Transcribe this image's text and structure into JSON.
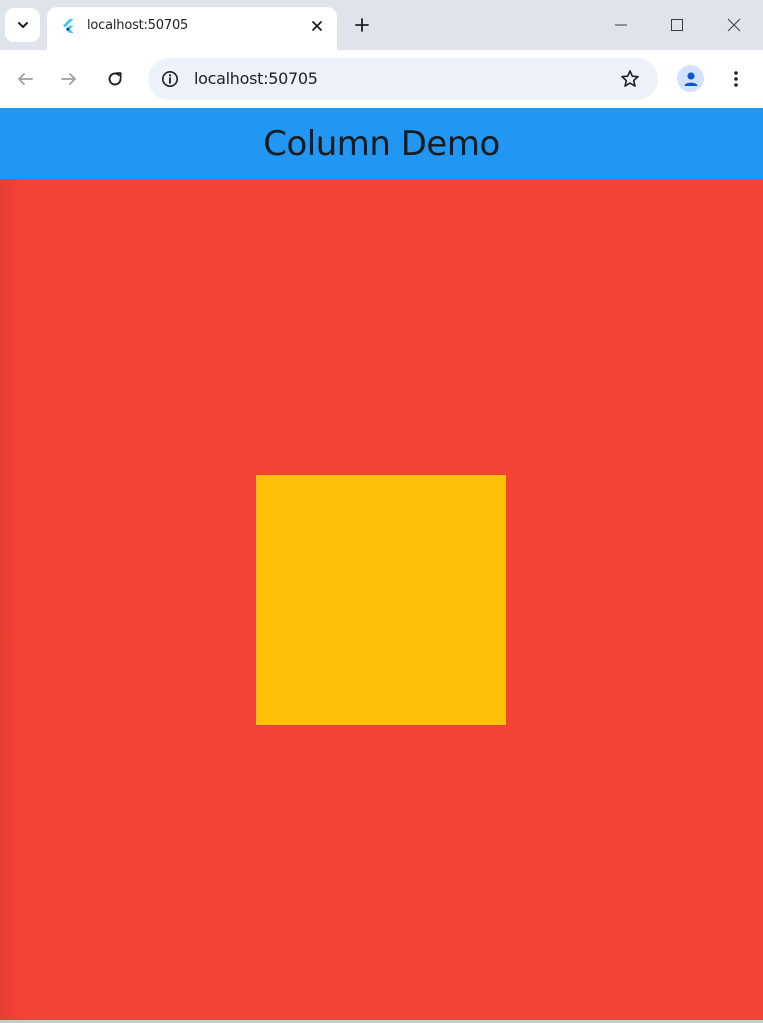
{
  "browser": {
    "tab": {
      "title": "localhost:50705"
    },
    "omnibox": {
      "url": "localhost:50705"
    }
  },
  "app": {
    "appbar": {
      "title": "Column Demo",
      "color": "#2196f3"
    },
    "body": {
      "background_color": "#f44336"
    },
    "box": {
      "color": "#ffc107"
    }
  },
  "icons": {
    "tab_search": "chevron-down-icon",
    "favicon": "flutter-logo-icon",
    "tab_close": "close-icon",
    "new_tab": "plus-icon",
    "minimize": "minimize-icon",
    "maximize": "maximize-icon",
    "close_window": "close-icon",
    "back": "arrow-left-icon",
    "forward": "arrow-right-icon",
    "reload": "reload-icon",
    "site_info": "info-icon",
    "bookmark": "star-icon",
    "profile": "person-icon",
    "menu": "more-vert-icon"
  }
}
